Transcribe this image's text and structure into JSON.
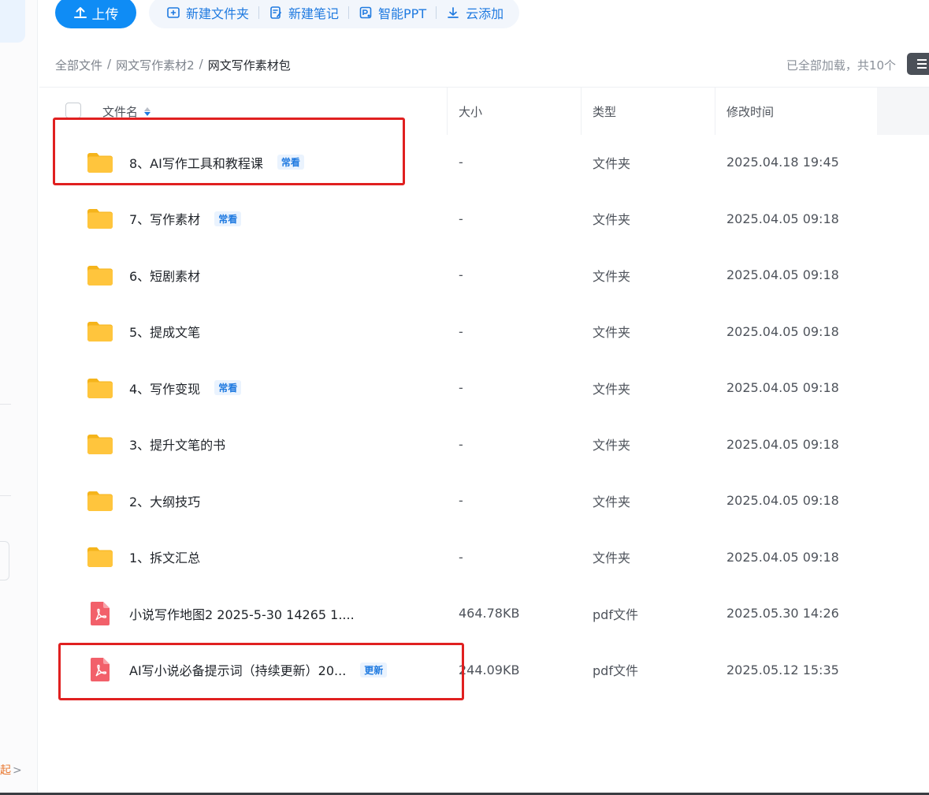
{
  "toolbar": {
    "upload_label": "上传",
    "new_folder_label": "新建文件夹",
    "new_note_label": "新建笔记",
    "smart_ppt_label": "智能PPT",
    "cloud_add_label": "云添加"
  },
  "breadcrumb": {
    "items": [
      "全部文件",
      "网文写作素材2",
      "网文写作素材包"
    ],
    "separator": "/"
  },
  "load_status": "已全部加载，共10个",
  "sidebar": {
    "bottom_link": "起",
    "bottom_chevron": ">"
  },
  "table": {
    "headers": {
      "name": "文件名",
      "size": "大小",
      "type": "类型",
      "modified": "修改时间"
    },
    "rows": [
      {
        "icon": "folder-icon",
        "name": "8、AI写作工具和教程课",
        "tag": "常看",
        "size": "-",
        "type": "文件夹",
        "modified": "2025.04.18 19:45"
      },
      {
        "icon": "folder-icon",
        "name": "7、写作素材",
        "tag": "常看",
        "size": "-",
        "type": "文件夹",
        "modified": "2025.04.05 09:18"
      },
      {
        "icon": "folder-icon",
        "name": "6、短剧素材",
        "tag": "",
        "size": "-",
        "type": "文件夹",
        "modified": "2025.04.05 09:18"
      },
      {
        "icon": "folder-icon",
        "name": "5、提成文笔",
        "tag": "",
        "size": "-",
        "type": "文件夹",
        "modified": "2025.04.05 09:18"
      },
      {
        "icon": "folder-icon",
        "name": "4、写作变现",
        "tag": "常看",
        "size": "-",
        "type": "文件夹",
        "modified": "2025.04.05 09:18"
      },
      {
        "icon": "folder-icon",
        "name": "3、提升文笔的书",
        "tag": "",
        "size": "-",
        "type": "文件夹",
        "modified": "2025.04.05 09:18"
      },
      {
        "icon": "folder-icon",
        "name": "2、大纲技巧",
        "tag": "",
        "size": "-",
        "type": "文件夹",
        "modified": "2025.04.05 09:18"
      },
      {
        "icon": "folder-icon",
        "name": "1、拆文汇总",
        "tag": "",
        "size": "-",
        "type": "文件夹",
        "modified": "2025.04.05 09:18"
      },
      {
        "icon": "pdf-icon",
        "name": "小说写作地图2 2025-5-30 14265 1....",
        "tag": "",
        "size": "464.78KB",
        "type": "pdf文件",
        "modified": "2025.05.30 14:26"
      },
      {
        "icon": "pdf-icon",
        "name": "AI写小说必备提示词（持续更新）20...",
        "tag": "更新",
        "size": "244.09KB",
        "type": "pdf文件",
        "modified": "2025.05.12 15:35"
      }
    ]
  },
  "colors": {
    "accent": "#0f8cf5",
    "link": "#1f7ae0",
    "folder": "#ffc53d",
    "pdf": "#f2606a",
    "highlight": "#e02020"
  }
}
